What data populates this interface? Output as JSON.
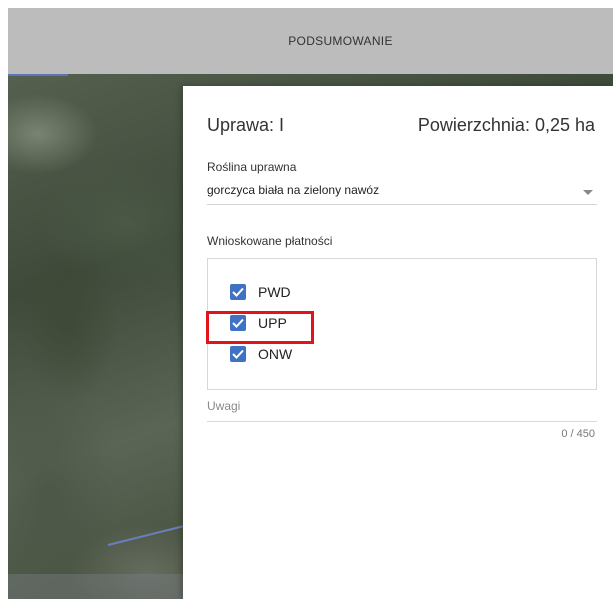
{
  "header": {
    "title": "PODSUMOWANIE"
  },
  "panel": {
    "uprawa": "Uprawa: I",
    "powierzchnia": "Powierzchnia: 0,25 ha",
    "crop_label": "Roślina uprawna",
    "crop_value": "gorczyca biała na zielony nawóz",
    "payments_label": "Wnioskowane płatności",
    "payments": [
      {
        "label": "PWD",
        "checked": true
      },
      {
        "label": "UPP",
        "checked": true
      },
      {
        "label": "ONW",
        "checked": true
      }
    ],
    "notes_label": "Uwagi",
    "notes_counter": "0 / 450"
  },
  "colors": {
    "accent": "#3f72c4",
    "highlight": "#e0141c",
    "header_bg": "#bcbcbc"
  },
  "icons": [
    "check-icon",
    "dropdown-arrow-icon"
  ]
}
